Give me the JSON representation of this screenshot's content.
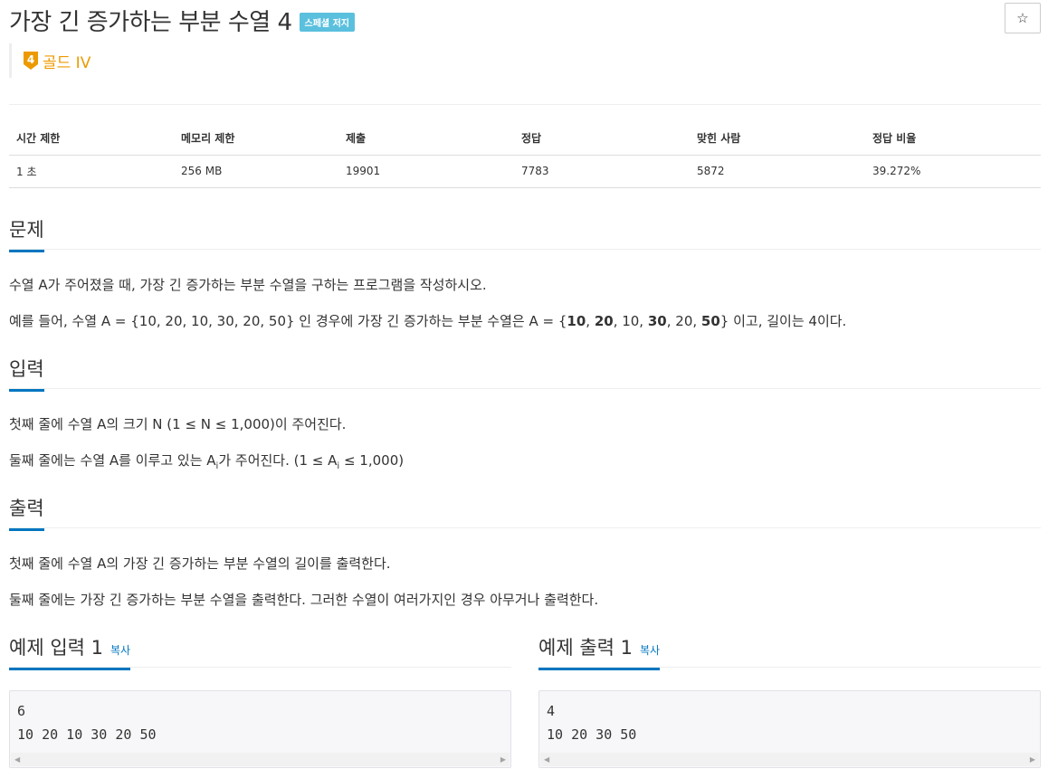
{
  "problem": {
    "title": "가장 긴 증가하는 부분 수열 4",
    "badge": "스페셜 저지",
    "tier_number": "4",
    "tier_label": "골드 IV",
    "star_label": "☆",
    "tier_color": "#ec9a00"
  },
  "info_table": {
    "headers": [
      "시간 제한",
      "메모리 제한",
      "제출",
      "정답",
      "맞힌 사람",
      "정답 비율"
    ],
    "values": [
      "1 초",
      "256 MB",
      "19901",
      "7783",
      "5872",
      "39.272%"
    ]
  },
  "sections": {
    "description": {
      "heading": "문제",
      "p1": "수열 A가 주어졌을 때, 가장 긴 증가하는 부분 수열을 구하는 프로그램을 작성하시오.",
      "p2_prefix": "예를 들어, 수열 A = {10, 20, 10, 30, 20, 50} 인 경우에 가장 긴 증가하는 부분 수열은 A = {",
      "p2_b1": "10",
      "p2_c1": ", ",
      "p2_b2": "20",
      "p2_c2": ", 10, ",
      "p2_b3": "30",
      "p2_c3": ", 20, ",
      "p2_b4": "50",
      "p2_suffix": "} 이고, 길이는 4이다."
    },
    "input": {
      "heading": "입력",
      "p1": "첫째 줄에 수열 A의 크기 N (1 ≤ N ≤ 1,000)이 주어진다.",
      "p2_prefix": "둘째 줄에는 수열 A를 이루고 있는 A",
      "p2_sub": "i",
      "p2_mid": "가 주어진다. (1 ≤ A",
      "p2_sub2": "i",
      "p2_suffix": " ≤ 1,000)"
    },
    "output": {
      "heading": "출력",
      "p1": "첫째 줄에 수열 A의 가장 긴 증가하는 부분 수열의 길이를 출력한다.",
      "p2": "둘째 줄에는 가장 긴 증가하는 부분 수열을 출력한다. 그러한 수열이 여러가지인 경우 아무거나 출력한다."
    }
  },
  "samples": {
    "input": {
      "heading": "예제 입력 1",
      "copy": "복사",
      "content": "6\n10 20 10 30 20 50"
    },
    "output": {
      "heading": "예제 출력 1",
      "copy": "복사",
      "content": "4\n10 20 30 50"
    }
  },
  "accent_color": "#0076c0",
  "badge_color": "#5bc0de"
}
